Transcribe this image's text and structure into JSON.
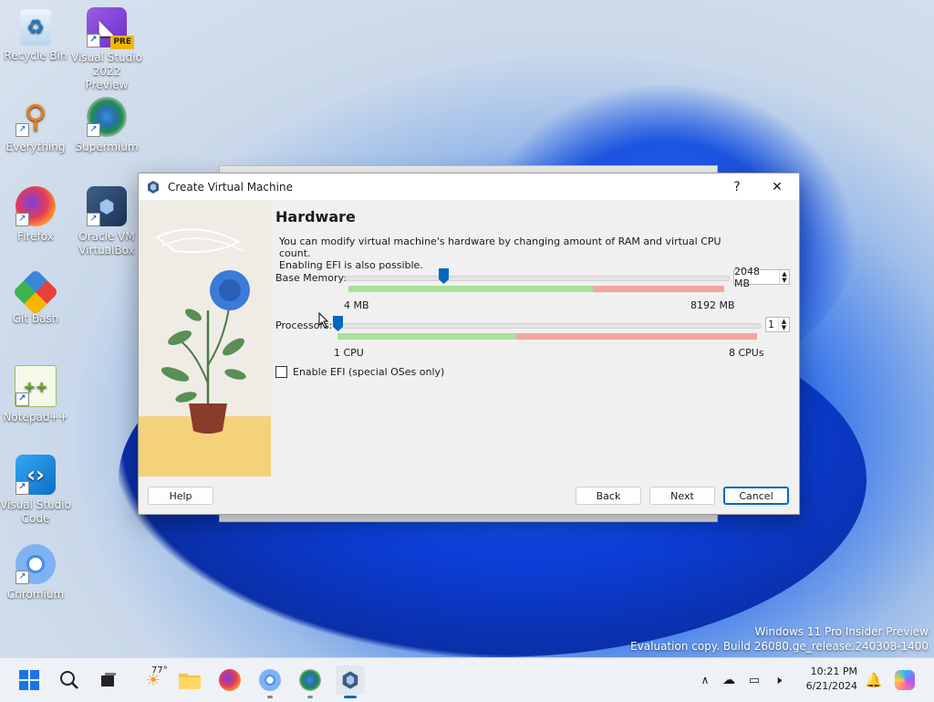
{
  "desktop": {
    "icons": [
      {
        "label": "Recycle Bin",
        "icon": "recycle-bin-icon"
      },
      {
        "label": "Visual Studio 2022 Preview",
        "icon": "visual-studio-icon",
        "badge": "PRE"
      },
      {
        "label": "Everything",
        "icon": "search-magnifier-icon"
      },
      {
        "label": "Supermium",
        "icon": "supermium-icon"
      },
      {
        "label": "Firefox",
        "icon": "firefox-icon"
      },
      {
        "label": "Oracle VM VirtualBox",
        "icon": "virtualbox-icon"
      },
      {
        "label": "Git Bash",
        "icon": "git-bash-icon"
      },
      {
        "label": "Notepad++",
        "icon": "notepad-plus-plus-icon"
      },
      {
        "label": "Visual Studio Code",
        "icon": "vscode-icon"
      },
      {
        "label": "Chromium",
        "icon": "chromium-icon"
      }
    ],
    "watermark_line1": "Windows 11 Pro Insider Preview",
    "watermark_line2": "Evaluation copy. Build 26080.ge_release.240308-1400"
  },
  "dialog": {
    "title": "Create Virtual Machine",
    "help_glyph": "?",
    "close_glyph": "✕",
    "heading": "Hardware",
    "description_line1": "You can modify virtual machine's hardware by changing amount of RAM and virtual CPU count.",
    "description_line2": "Enabling EFI is also possible.",
    "memory": {
      "label": "Base Memory:",
      "value": "2048 MB",
      "min_label": "4 MB",
      "max_label": "8192 MB",
      "fraction": 0.25
    },
    "processors": {
      "label": "Processors:",
      "value": "1",
      "min_label": "1 CPU",
      "max_label": "8 CPUs",
      "fraction": 0.0
    },
    "efi_checkbox_label": "Enable EFI (special OSes only)",
    "efi_checked": false,
    "buttons": {
      "help": "Help",
      "back": "Back",
      "next": "Next",
      "cancel": "Cancel"
    }
  },
  "taskbar": {
    "weather_temp": "77°",
    "apps": [
      "start-icon",
      "search-icon",
      "task-view-icon",
      "weather-icon",
      "file-explorer-icon",
      "firefox-icon",
      "chromium-icon",
      "supermium-icon",
      "virtualbox-icon"
    ],
    "clock_time": "10:21 PM",
    "clock_date": "6/21/2024"
  },
  "colors": {
    "accent": "#0067c0",
    "green_zone": "#a8e29a",
    "red_zone": "#f2a6a0"
  }
}
